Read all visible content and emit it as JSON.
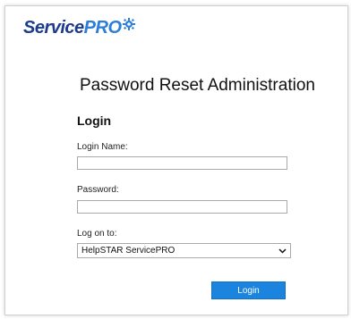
{
  "brand": {
    "name_part1": "Service",
    "name_part2": "PRO",
    "colors": {
      "primary": "#1d3d8c",
      "accent": "#2b7fd6"
    },
    "icon": "gear-icon"
  },
  "page": {
    "title": "Password Reset Administration",
    "section_title": "Login"
  },
  "form": {
    "login_name_label": "Login Name:",
    "login_name_value": "",
    "password_label": "Password:",
    "password_value": "",
    "logon_to_label": "Log on to:",
    "logon_to_selected": "HelpSTAR ServicePRO",
    "select_icon": "chevron-down-icon",
    "login_button_label": "Login",
    "button_color": "#1a84de"
  }
}
